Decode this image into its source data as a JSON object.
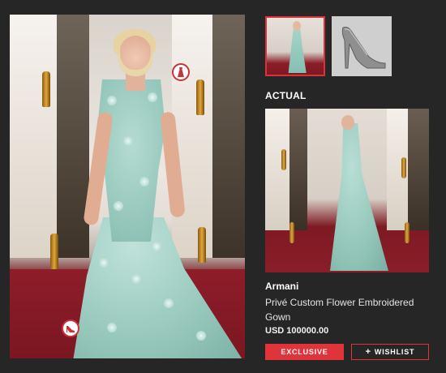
{
  "section": {
    "title": "ACTUAL"
  },
  "product": {
    "brand": "Armani",
    "name": "Privé Custom Flower Embroidered Gown",
    "price": "USD 100000.00"
  },
  "buttons": {
    "exclusive": "EXCLUSIVE",
    "wishlist_icon": "+",
    "wishlist": "WISHLIST"
  },
  "hotspots": [
    {
      "icon": "dress-icon"
    },
    {
      "icon": "shoe-icon"
    }
  ],
  "thumbnails": [
    {
      "icon": "gown-thumbnail",
      "active": true
    },
    {
      "icon": "shoe-thumbnail",
      "active": false
    }
  ],
  "colors": {
    "accent": "#e0333a",
    "background": "#262626"
  }
}
